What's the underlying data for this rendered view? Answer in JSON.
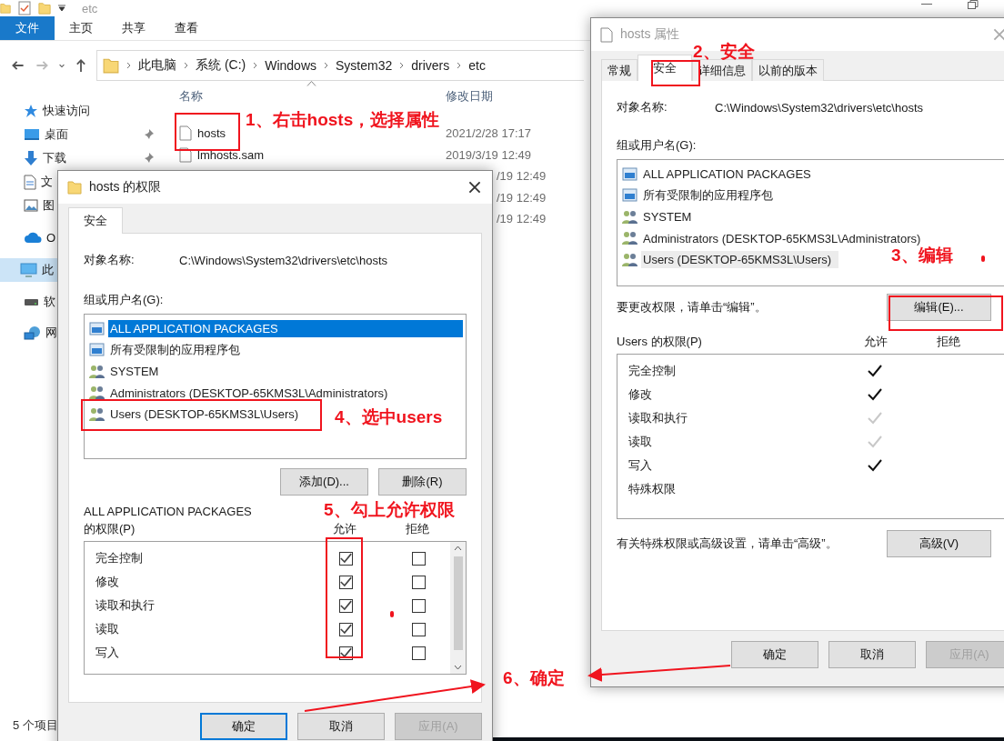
{
  "explorer": {
    "title": "etc",
    "ribbon_tabs": [
      {
        "label": "文件",
        "selected": true
      },
      {
        "label": "主页",
        "selected": false
      },
      {
        "label": "共享",
        "selected": false
      },
      {
        "label": "查看",
        "selected": false
      }
    ],
    "breadcrumb": [
      "此电脑",
      "系统 (C:)",
      "Windows",
      "System32",
      "drivers",
      "etc"
    ],
    "sidebar": [
      {
        "label": "快速访问",
        "kind": "star",
        "pinned": false,
        "selected": false
      },
      {
        "label": "桌面",
        "kind": "desktop",
        "pinned": true,
        "selected": false
      },
      {
        "label": "下载",
        "kind": "download",
        "pinned": true,
        "selected": false
      },
      {
        "label": "文",
        "kind": "document",
        "pinned": false,
        "selected": false
      },
      {
        "label": "图",
        "kind": "image",
        "pinned": false,
        "selected": false
      },
      {
        "label": "O",
        "kind": "cloud",
        "pinned": false,
        "selected": false
      },
      {
        "label": "此",
        "kind": "computer",
        "pinned": false,
        "selected": true
      },
      {
        "label": "软",
        "kind": "drive",
        "pinned": false,
        "selected": false
      },
      {
        "label": "网",
        "kind": "network",
        "pinned": false,
        "selected": false
      }
    ],
    "columns": [
      "名称",
      "修改日期"
    ],
    "files": [
      {
        "name": "hosts",
        "modified": "2021/2/28 17:17"
      },
      {
        "name": "lmhosts.sam",
        "modified": "2019/3/19 12:49"
      },
      {
        "modified": "/19 12:49"
      },
      {
        "modified": "/19 12:49"
      },
      {
        "modified": "/19 12:49"
      }
    ],
    "status": "5 个项目"
  },
  "perm_dialog": {
    "title": "hosts 的权限",
    "tab": "安全",
    "object_label": "对象名称:",
    "object_value": "C:\\Windows\\System32\\drivers\\etc\\hosts",
    "group_label": "组或用户名(G):",
    "groups": [
      {
        "name": "ALL APPLICATION PACKAGES",
        "kind": "package",
        "selected": true
      },
      {
        "name": "所有受限制的应用程序包",
        "kind": "package",
        "selected": false
      },
      {
        "name": "SYSTEM",
        "kind": "users",
        "selected": false
      },
      {
        "name": "Administrators (DESKTOP-65KMS3L\\Administrators)",
        "kind": "users",
        "selected": false
      },
      {
        "name": "Users (DESKTOP-65KMS3L\\Users)",
        "kind": "users",
        "selected": false
      }
    ],
    "add_button": "添加(D)...",
    "remove_button": "删除(R)",
    "perm_heading": "ALL APPLICATION PACKAGES",
    "perm_heading_2": "的权限(P)",
    "allow_header": "允许",
    "deny_header": "拒绝",
    "permissions": [
      {
        "name": "完全控制",
        "allow": true,
        "deny": false
      },
      {
        "name": "修改",
        "allow": true,
        "deny": false
      },
      {
        "name": "读取和执行",
        "allow": true,
        "deny": false
      },
      {
        "name": "读取",
        "allow": true,
        "deny": false
      },
      {
        "name": "写入",
        "allow": true,
        "deny": false
      }
    ],
    "buttons": [
      {
        "label": "确定",
        "disabled": false,
        "default": true
      },
      {
        "label": "取消",
        "disabled": false,
        "default": false
      },
      {
        "label": "应用(A)",
        "disabled": true,
        "default": false
      }
    ]
  },
  "props_dialog": {
    "title": "hosts 属性",
    "tabs": [
      {
        "label": "常规",
        "selected": false
      },
      {
        "label": "安全",
        "selected": true
      },
      {
        "label": "详细信息",
        "selected": false
      },
      {
        "label": "以前的版本",
        "selected": false
      }
    ],
    "object_label": "对象名称:",
    "object_value": "C:\\Windows\\System32\\drivers\\etc\\hosts",
    "group_label": "组或用户名(G):",
    "groups": [
      {
        "name": "ALL APPLICATION PACKAGES",
        "kind": "package",
        "selected": false
      },
      {
        "name": "所有受限制的应用程序包",
        "kind": "package",
        "selected": false
      },
      {
        "name": "SYSTEM",
        "kind": "users",
        "selected": false
      },
      {
        "name": "Administrators (DESKTOP-65KMS3L\\Administrators)",
        "kind": "users",
        "selected": false
      },
      {
        "name": "Users (DESKTOP-65KMS3L\\Users)",
        "kind": "users",
        "selected": true
      }
    ],
    "edit_hint": "要更改权限，请单击“编辑”。",
    "edit_button": "编辑(E)...",
    "perm_heading": "Users 的权限(P)",
    "allow_header": "允许",
    "deny_header": "拒绝",
    "permissions": [
      {
        "name": "完全控制",
        "allow": true,
        "inherited": false
      },
      {
        "name": "修改",
        "allow": true,
        "inherited": false
      },
      {
        "name": "读取和执行",
        "allow": true,
        "inherited": true
      },
      {
        "name": "读取",
        "allow": true,
        "inherited": true
      },
      {
        "name": "写入",
        "allow": true,
        "inherited": false
      },
      {
        "name": "特殊权限",
        "allow": false
      }
    ],
    "advanced_hint": "有关特殊权限或高级设置，请单击“高级”。",
    "advanced_button": "高级(V)",
    "buttons": [
      {
        "label": "确定",
        "disabled": false,
        "default": false
      },
      {
        "label": "取消",
        "disabled": false,
        "default": false
      },
      {
        "label": "应用(A)",
        "disabled": true,
        "default": false
      }
    ]
  },
  "annotations": [
    "1、右击hosts，选择属性",
    "2、安全",
    "3、编辑",
    "4、选中users",
    "5、勾上允许权限",
    "6、确定"
  ]
}
